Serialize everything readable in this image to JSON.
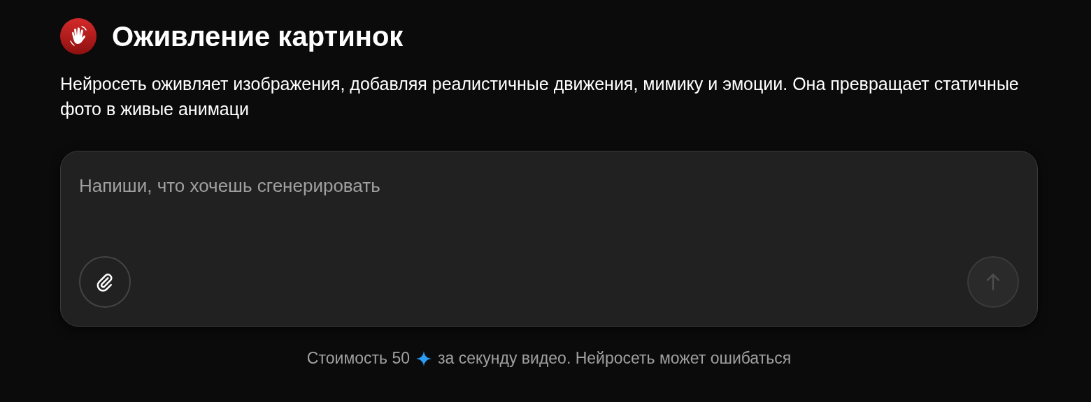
{
  "header": {
    "title": "Оживление картинок"
  },
  "description": "Нейросеть оживляет изображения, добавляя реалистичные движения, мимику и эмоции. Она превращает статичные фото в живые анимаци",
  "prompt": {
    "placeholder": "Напиши, что хочешь сгенерировать",
    "send_disabled": true
  },
  "footer": {
    "before": "Стоимость 50",
    "after": "за секунду видео. Нейросеть может ошибаться"
  }
}
